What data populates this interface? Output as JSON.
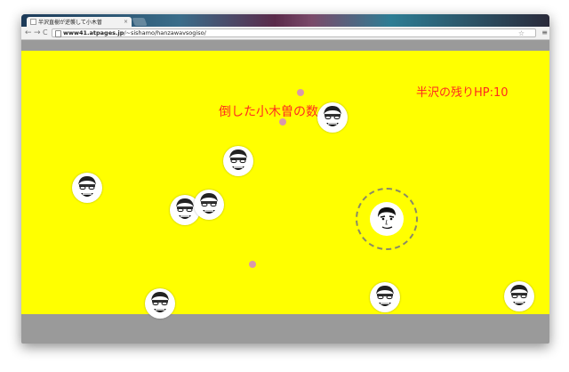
{
  "browser": {
    "tab_title": "半沢直樹が逆襲して小木曽",
    "tab_close": "×",
    "nav_back": "←",
    "nav_forward": "→",
    "nav_reload": "C",
    "url_host": "www41.atpages.jp",
    "url_path": "/~sishamo/hanzawavsogiso/",
    "star": "☆",
    "menu": "≡"
  },
  "game": {
    "hp_text": "半沢の残りHP:10",
    "kills_text": "倒した小木曽の数"
  },
  "colors": {
    "background": "#ffff00",
    "text": "#ff2b1e",
    "bullet": "#d999aa",
    "frame": "#9a9a9a"
  },
  "icons": {
    "enemy": "ogiso-face-icon",
    "player": "hanzawa-face-icon"
  }
}
